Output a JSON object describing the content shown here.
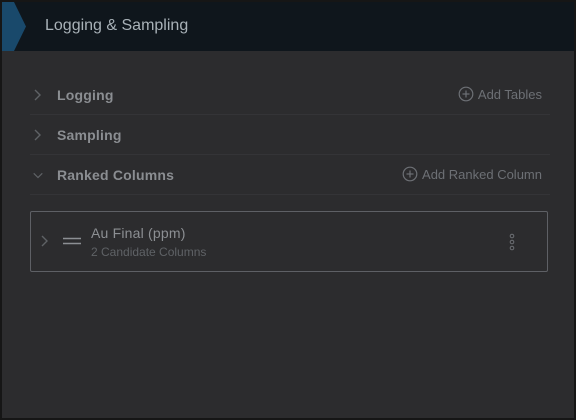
{
  "header": {
    "title": "Logging & Sampling"
  },
  "sections": [
    {
      "label": "Logging",
      "expanded": false,
      "action_label": "Add Tables"
    },
    {
      "label": "Sampling",
      "expanded": false
    },
    {
      "label": "Ranked Columns",
      "expanded": true,
      "action_label": "Add Ranked Column"
    }
  ],
  "ranked_columns": [
    {
      "title": "Au Final (ppm)",
      "subtitle": "2 Candidate Columns"
    }
  ],
  "icons": {
    "header_accent": "chevron-accent-icon",
    "collapsed": "chevron-right-icon",
    "expanded": "chevron-down-icon",
    "add": "plus-circle-icon",
    "drag": "drag-handle-icon",
    "menu": "kebab-menu-icon"
  },
  "colors": {
    "header_bg": "#0f161c",
    "accent": "#1d5b86",
    "panel_bg": "#2c2c2e"
  }
}
